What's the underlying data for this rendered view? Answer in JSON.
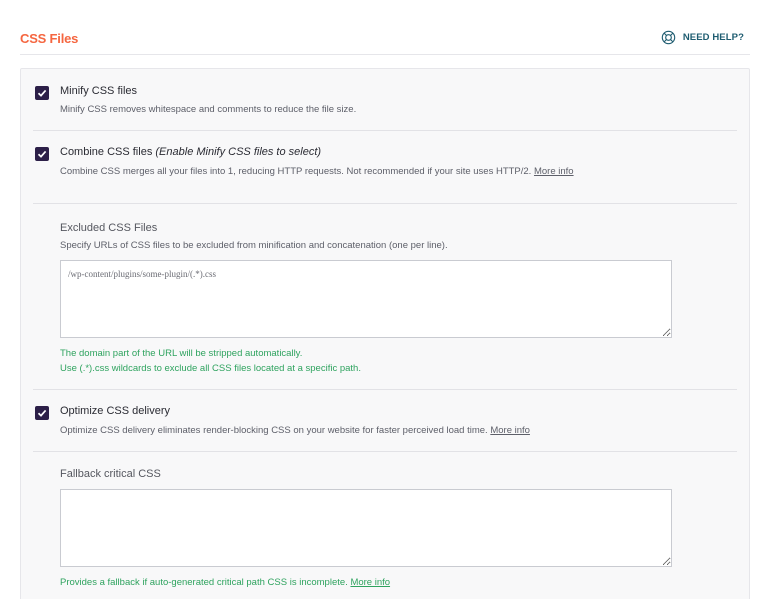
{
  "section": {
    "title": "CSS Files",
    "help_label": "NEED HELP?"
  },
  "options": {
    "minify": {
      "label": "Minify CSS files",
      "checked": true,
      "description": "Minify CSS removes whitespace and comments to reduce the file size."
    },
    "combine": {
      "label": "Combine CSS files",
      "label_note": "(Enable Minify CSS files to select)",
      "checked": true,
      "description": "Combine CSS merges all your files into 1, reducing HTTP requests. Not recommended if your site uses HTTP/2.",
      "more_info": "More info"
    },
    "excluded": {
      "label": "Excluded CSS Files",
      "description": "Specify URLs of CSS files to be excluded from minification and concatenation (one per line).",
      "placeholder": "/wp-content/plugins/some-plugin/(.*).css",
      "value": "",
      "hint_line1": "The domain part of the URL will be stripped automatically.",
      "hint_line2": "Use (.*).css wildcards to exclude all CSS files located at a specific path."
    },
    "optimize": {
      "label": "Optimize CSS delivery",
      "checked": true,
      "description": "Optimize CSS delivery eliminates render-blocking CSS on your website for faster perceived load time.",
      "more_info": "More info"
    },
    "fallback": {
      "label": "Fallback critical CSS",
      "value": "",
      "hint": "Provides a fallback if auto-generated critical path CSS is incomplete.",
      "more_info": "More info"
    }
  },
  "colors": {
    "accent": "#f56640",
    "checkbox": "#2c1f48",
    "help": "#1e5c70",
    "hint": "#2fa35f"
  },
  "icons": {
    "help": "lifebuoy-icon",
    "check": "checkmark-icon"
  }
}
